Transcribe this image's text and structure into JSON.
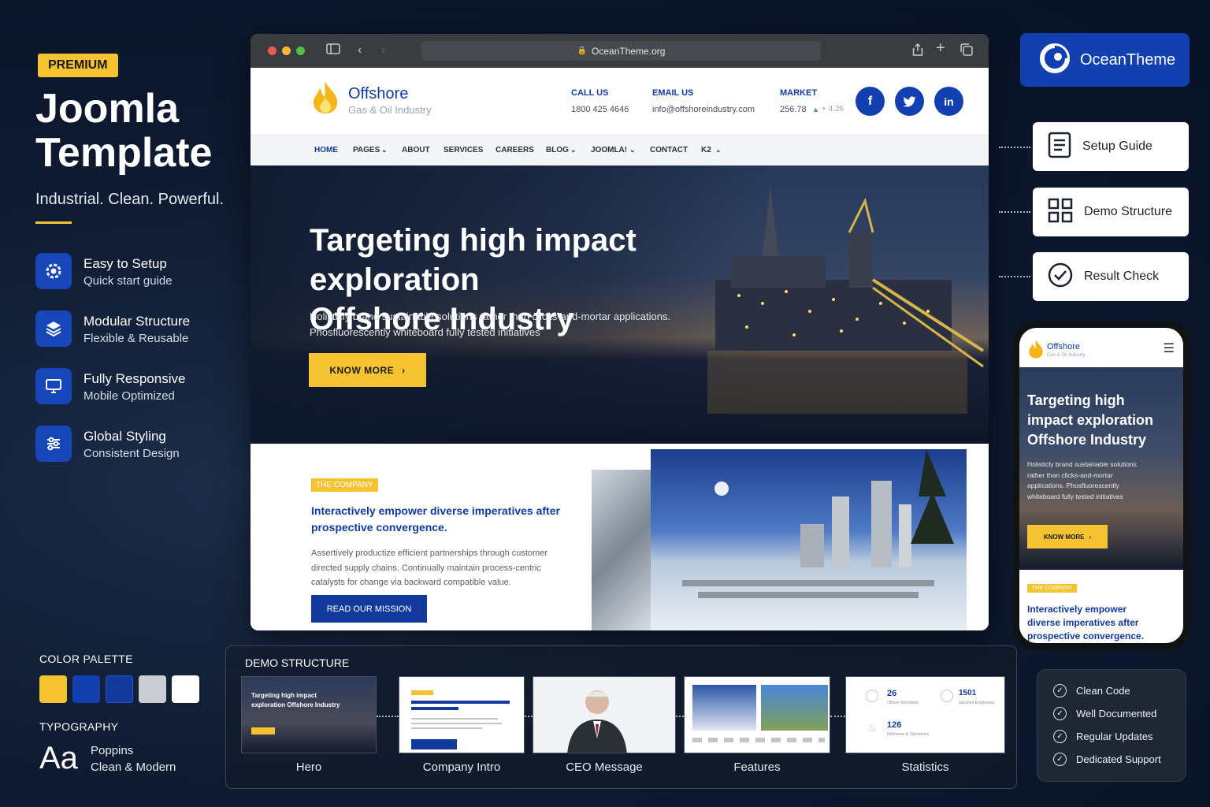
{
  "promo": {
    "badge": "PREMIUM",
    "title": "Joomla Template",
    "tagline": "Industrial. Clean. Powerful.",
    "features": [
      {
        "title": "Easy to Setup",
        "subtitle": "Quick start guide",
        "icon": "gear-icon"
      },
      {
        "title": "Modular Structure",
        "subtitle": "Flexible & Reusable",
        "icon": "layers-icon"
      },
      {
        "title": "Fully Responsive",
        "subtitle": "Mobile Optimized",
        "icon": "monitor-icon"
      },
      {
        "title": "Global Styling",
        "subtitle": "Consistent Design",
        "icon": "sliders-icon"
      }
    ],
    "palette_label": "COLOR PALETTE",
    "palette": [
      "#f5c332",
      "#1240b0",
      "#123a9c",
      "#c9ccd1",
      "#ffffff"
    ],
    "typography_label": "TYPOGRAPHY",
    "typo_sample": "Aa",
    "font_name": "Poppins",
    "font_desc": "Clean & Modern"
  },
  "browser": {
    "url": "OceanTheme.org",
    "site": {
      "logo_title": "Offshore",
      "logo_sub": "Gas & Oil Industry",
      "call_label": "CALL US",
      "call_value": "1800 425 4646",
      "email_label": "EMAIL US",
      "email_value": "info@offshoreindustry.com",
      "market_label": "MARKET",
      "market_value": "256.78",
      "market_change": "+ 4.26",
      "social": [
        "f",
        "t",
        "in"
      ],
      "nav": [
        "HOME",
        "PAGES",
        "ABOUT",
        "SERVICES",
        "CAREERS",
        "BLOG",
        "JOOMLA!",
        "CONTACT",
        "K2"
      ],
      "hero_title_1": "Targeting high impact exploration",
      "hero_title_2": "Offshore Industry",
      "hero_sub_1": "Holisticly brand sustainable solutions rather than clicks-and-mortar applications.",
      "hero_sub_2": "Phosfluorescently whiteboard fully tested initiatives",
      "hero_btn": "KNOW MORE",
      "company_tag": "THE COMPANY",
      "company_heading": "Interactively empower diverse imperatives after prospective convergence.",
      "company_text": "Assertively productize efficient partnerships through customer directed supply chains. Continually maintain process-centric catalysts for change via backward compatible value.",
      "company_btn": "READ OUR MISSION"
    }
  },
  "brand": "OceanTheme",
  "cards": [
    "Setup Guide",
    "Demo Structure",
    "Result Check"
  ],
  "phone": {
    "logo": "Offshore",
    "logo_sub": "Gas & Oil Industry",
    "hero_title": "Targeting high impact exploration Offshore Industry",
    "hero_sub": "Holisticly brand sustainable solutions rather than clicks-and-mortar applications. Phosfluorescently whiteboard fully tested initiatives",
    "btn": "KNOW MORE",
    "tag": "THE COMPANY",
    "heading": "Interactively empower diverse imperatives after prospective convergence."
  },
  "demo": {
    "label": "DEMO STRUCTURE",
    "items": [
      "Hero",
      "Company Intro",
      "CEO Message",
      "Features",
      "Statistics"
    ],
    "hero_thumb_title": "Targeting high impact exploration Offshore Industry",
    "stats": [
      {
        "value": "26",
        "label": "Offices Worldwide"
      },
      {
        "value": "1501",
        "label": "Satisfied Employees"
      },
      {
        "value": "126",
        "label": "Refineries & Operations"
      }
    ]
  },
  "checks": [
    "Clean Code",
    "Well Documented",
    "Regular Updates",
    "Dedicated Support"
  ]
}
